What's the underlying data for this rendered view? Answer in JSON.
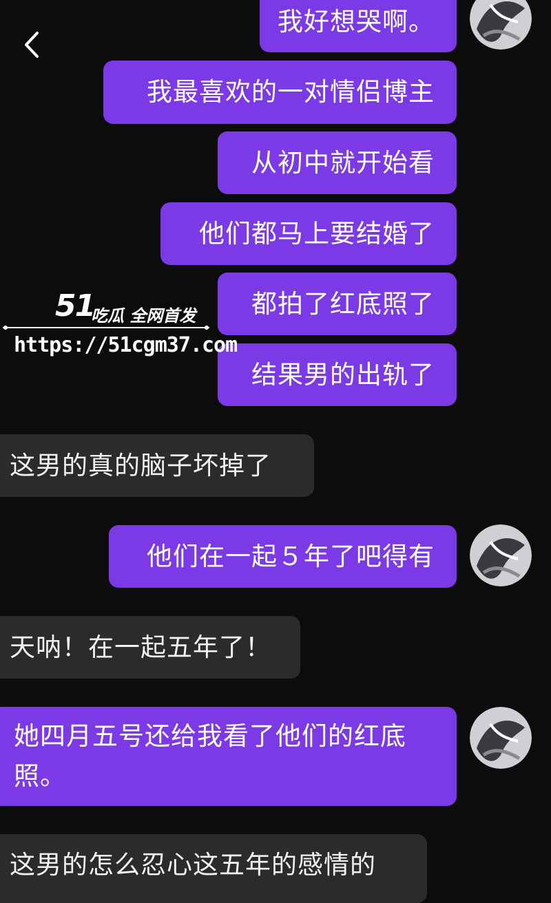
{
  "chat": {
    "back_icon": "chevron-left-icon",
    "avatar_icon": "user-avatar-icon",
    "messages": [
      {
        "side": "out",
        "text": "我好想哭啊。"
      },
      {
        "side": "out",
        "text": "我最喜欢的一对情侣博主"
      },
      {
        "side": "out",
        "text": "从初中就开始看"
      },
      {
        "side": "out",
        "text": "他们都马上要结婚了"
      },
      {
        "side": "out",
        "text": "都拍了红底照了"
      },
      {
        "side": "out",
        "text": "结果男的出轨了"
      },
      {
        "side": "in",
        "text": "这男的真的脑子坏掉了"
      },
      {
        "side": "out",
        "text": "他们在一起５年了吧得有"
      },
      {
        "side": "in",
        "text": "天呐！在一起五年了！"
      },
      {
        "side": "out",
        "text": "她四月五号还给我看了他们的红底照。"
      },
      {
        "side": "in",
        "text": "这男的怎么忍心这五年的感情的"
      }
    ]
  },
  "watermark": {
    "brand": "51",
    "tagline": "吃瓜 全网首发",
    "url": "https://51cgm37.com"
  },
  "colors": {
    "background": "#0c0c0d",
    "outgoing_bubble": "#7c3ae6",
    "incoming_bubble": "#2b2b2e"
  }
}
